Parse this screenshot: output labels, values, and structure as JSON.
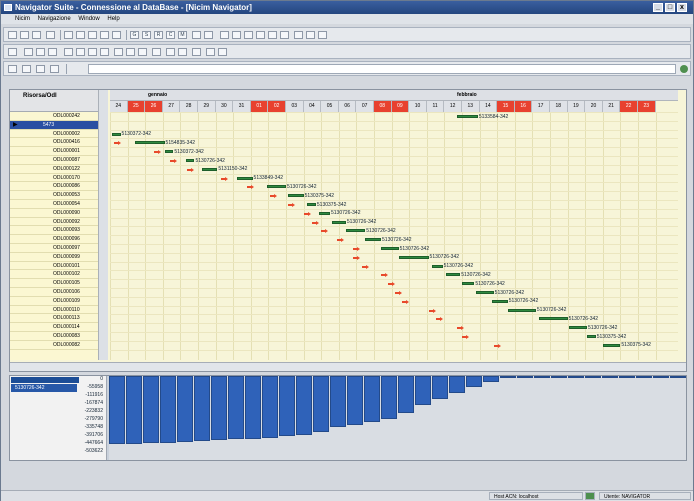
{
  "window": {
    "title": "Navigator Suite - Connessione al DataBase - [Nicim Navigator]",
    "controls": [
      "_",
      "□",
      "x"
    ]
  },
  "menu": [
    "Nicim",
    "Navigazione",
    "Window",
    "Help"
  ],
  "toolbar1": {
    "letters": [
      "G",
      "S",
      "R",
      "C",
      "M"
    ]
  },
  "gantt": {
    "header": "Risorsa/Odl",
    "months": [
      "gennaio",
      "febbraio"
    ],
    "days": [
      "24",
      "25",
      "26",
      "27",
      "28",
      "29",
      "30",
      "31",
      "01",
      "02",
      "03",
      "04",
      "05",
      "06",
      "07",
      "08",
      "09",
      "10",
      "11",
      "12",
      "13",
      "14",
      "15",
      "16",
      "17",
      "18",
      "19",
      "20",
      "21",
      "22",
      "23"
    ],
    "holidays": [
      "25",
      "26",
      "01",
      "02",
      "08",
      "09",
      "15",
      "16",
      "22",
      "23"
    ],
    "rows": [
      "ODL000242",
      "5473",
      "ODL000002",
      "ODL000416",
      "ODL000001",
      "ODL000087",
      "ODL000122",
      "ODL000170",
      "ODL000086",
      "ODL000053",
      "ODL000054",
      "ODL000090",
      "ODL000092",
      "ODL000093",
      "ODL000096",
      "ODL000097",
      "ODL000099",
      "ODL000101",
      "ODL000102",
      "ODL000105",
      "ODL000106",
      "ODL000109",
      "ODL000110",
      "ODL000113",
      "ODL000114",
      "ODL000083",
      "ODL000082"
    ],
    "selected_row": "5473",
    "bars": [
      {
        "row": 0,
        "start": 19.7,
        "len": 1.2,
        "label": "5133584-342"
      },
      {
        "row": 2,
        "start": 0.1,
        "len": 0.5,
        "label": "5130372-342"
      },
      {
        "row": 3,
        "start": 1.4,
        "len": 1.7,
        "label": "5154835-342"
      },
      {
        "row": 4,
        "start": 3.1,
        "len": 0.5,
        "label": "5130372-342"
      },
      {
        "row": 5,
        "start": 4.3,
        "len": 0.5,
        "label": "5130726-342"
      },
      {
        "row": 6,
        "start": 5.2,
        "len": 0.9,
        "label": "5131150-342"
      },
      {
        "row": 7,
        "start": 7.2,
        "len": 0.9,
        "label": "5133849-342"
      },
      {
        "row": 8,
        "start": 8.9,
        "len": 1.1,
        "label": "5130726-342"
      },
      {
        "row": 9,
        "start": 10.1,
        "len": 0.9,
        "label": "5130375-342"
      },
      {
        "row": 10,
        "start": 11.2,
        "len": 0.5,
        "label": "5130375-342"
      },
      {
        "row": 11,
        "start": 11.9,
        "len": 0.6,
        "label": "5130726-342"
      },
      {
        "row": 12,
        "start": 12.6,
        "len": 0.8,
        "label": "5130726-342"
      },
      {
        "row": 13,
        "start": 13.4,
        "len": 1.1,
        "label": "5130726-342"
      },
      {
        "row": 14,
        "start": 14.5,
        "len": 0.9,
        "label": "5130726-342"
      },
      {
        "row": 15,
        "start": 15.4,
        "len": 1.0,
        "label": "5130726-342"
      },
      {
        "row": 16,
        "start": 16.4,
        "len": 1.7,
        "label": "5130726-342"
      },
      {
        "row": 17,
        "start": 18.3,
        "len": 0.6,
        "label": "5130726-342"
      },
      {
        "row": 18,
        "start": 19.1,
        "len": 0.8,
        "label": "5130726-342"
      },
      {
        "row": 19,
        "start": 20.0,
        "len": 0.7,
        "label": "5130726-342"
      },
      {
        "row": 20,
        "start": 20.8,
        "len": 1.0,
        "label": "5130726-342"
      },
      {
        "row": 21,
        "start": 21.7,
        "len": 0.9,
        "label": "5130726-342"
      },
      {
        "row": 22,
        "start": 22.6,
        "len": 1.6,
        "label": "5130726-342"
      },
      {
        "row": 23,
        "start": 24.4,
        "len": 1.6,
        "label": "5130726-342"
      },
      {
        "row": 24,
        "start": 26.1,
        "len": 1.0,
        "label": "5130726-342"
      },
      {
        "row": 25,
        "start": 27.1,
        "len": 0.5,
        "label": "5130375-342"
      },
      {
        "row": 26,
        "start": 28.0,
        "len": 1.0,
        "label": "5130375-342"
      }
    ],
    "arrows": [
      {
        "row": 3,
        "day": 0.2
      },
      {
        "row": 4,
        "day": 2.5
      },
      {
        "row": 5,
        "day": 3.4
      },
      {
        "row": 6,
        "day": 4.4
      },
      {
        "row": 7,
        "day": 6.3
      },
      {
        "row": 8,
        "day": 7.8
      },
      {
        "row": 9,
        "day": 9.1
      },
      {
        "row": 10,
        "day": 10.1
      },
      {
        "row": 11,
        "day": 11.0
      },
      {
        "row": 12,
        "day": 11.5
      },
      {
        "row": 13,
        "day": 12.0
      },
      {
        "row": 14,
        "day": 12.9
      },
      {
        "row": 15,
        "day": 13.8
      },
      {
        "row": 16,
        "day": 13.8
      },
      {
        "row": 17,
        "day": 14.3
      },
      {
        "row": 18,
        "day": 15.4
      },
      {
        "row": 19,
        "day": 15.8
      },
      {
        "row": 20,
        "day": 16.2
      },
      {
        "row": 21,
        "day": 16.6
      },
      {
        "row": 22,
        "day": 18.1
      },
      {
        "row": 23,
        "day": 18.5
      },
      {
        "row": 24,
        "day": 19.7
      },
      {
        "row": 25,
        "day": 20.0
      },
      {
        "row": 26,
        "day": 21.8
      }
    ]
  },
  "lower": {
    "selected": "5130726-342",
    "ylabels": [
      "0",
      "-55958",
      "-111916",
      "-167874",
      "-223832",
      "-279790",
      "-335748",
      "-391706",
      "-447664",
      "-503622"
    ],
    "values": [
      -478000,
      -478000,
      -472000,
      -466000,
      -461000,
      -455000,
      -450000,
      -444000,
      -439000,
      -433000,
      -420000,
      -410000,
      -390000,
      -360000,
      -340000,
      -320000,
      -300000,
      -260000,
      -200000,
      -160000,
      -120000,
      -80000,
      -40000,
      -15000,
      -6000,
      -6000,
      -6000,
      -6000,
      -6000,
      -6000,
      -6000,
      -6000,
      -6000,
      -6000
    ]
  },
  "status": {
    "host": "Host ACN: localhost",
    "user": "Utente: NAVIGATOR"
  }
}
